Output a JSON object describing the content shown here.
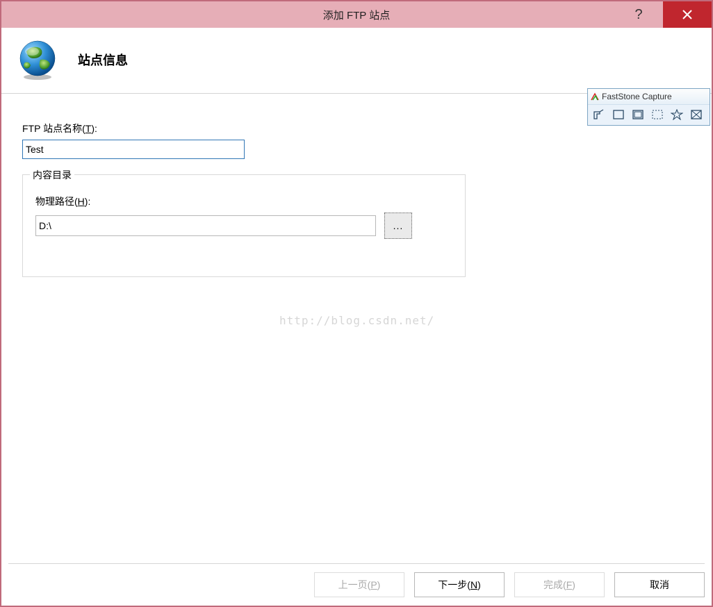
{
  "window": {
    "title": "添加 FTP 站点",
    "help_symbol": "?"
  },
  "header": {
    "heading": "站点信息"
  },
  "form": {
    "site_name_label_pre": "FTP 站点名称(",
    "site_name_accel": "T",
    "site_name_label_post": "):",
    "site_name_value": "Test",
    "fieldset_legend": "内容目录",
    "physical_path_label_pre": "物理路径(",
    "physical_path_accel": "H",
    "physical_path_label_post": "):",
    "physical_path_value": "D:\\",
    "browse_label": "..."
  },
  "watermark": "http://blog.csdn.net/",
  "footer": {
    "prev_pre": "上一页(",
    "prev_accel": "P",
    "prev_post": ")",
    "next_pre": "下一步(",
    "next_accel": "N",
    "next_post": ")",
    "finish_pre": "完成(",
    "finish_accel": "F",
    "finish_post": ")",
    "cancel": "取消"
  },
  "faststone": {
    "title": "FastStone Capture"
  }
}
